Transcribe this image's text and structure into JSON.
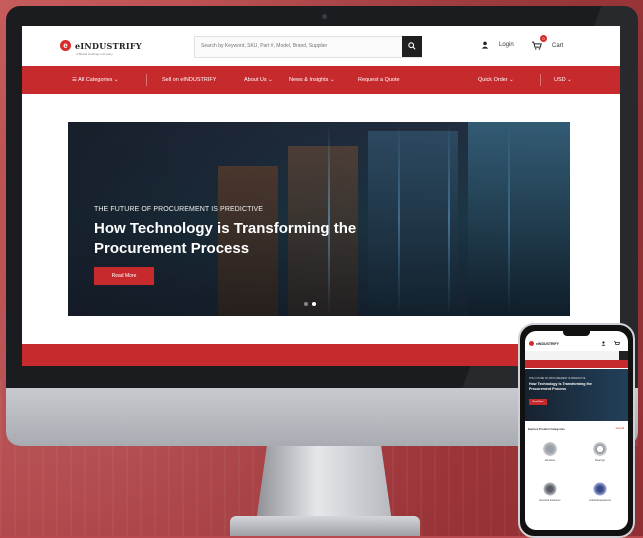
{
  "site": {
    "logo_text": "eINDUSTRIFY",
    "logo_sub": "A Bhatia Holdings company",
    "search_placeholder": "Search by Keyword, SKU, Part #, Model, Brand, Supplier",
    "login_label": "Login",
    "cart_label": "Cart",
    "cart_count": "0"
  },
  "nav": {
    "all_categories": "☰ All Categories ⌄",
    "sell": "Sell on eINDUSTRIFY",
    "about": "About Us ⌄",
    "news": "News & Insights ⌄",
    "quote": "Request a Quote",
    "quick_order": "Quick Order ⌄",
    "currency": "USD ⌄"
  },
  "hero": {
    "kicker": "THE FUTURE OF PROCUREMENT IS PREDICTIVE",
    "title": "How Technology is Transforming the Procurement Process",
    "button": "Read More",
    "slides": 2,
    "active_slide": 2
  },
  "phone": {
    "kicker": "THE FUTURE OF PROCUREMENT IS PREDICTIVE",
    "title": "How Technology is Transforming the Procurement Process",
    "button": "Read More",
    "section_title": "Explore Product Categories",
    "view_all": "View All",
    "categories": [
      "Abrasives",
      "Bearings",
      "Electrical Fasteners",
      "Industrial Equipment"
    ]
  },
  "colors": {
    "brand_red": "#c62a2d",
    "dark": "#1f1f1f"
  }
}
